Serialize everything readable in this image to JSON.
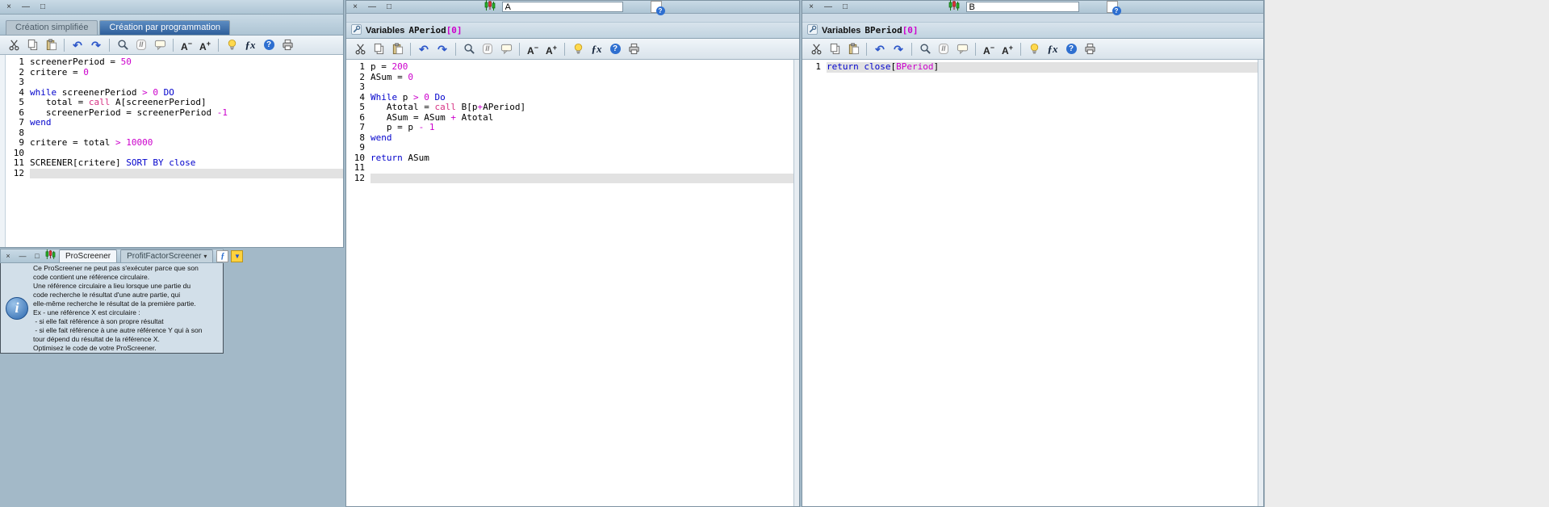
{
  "window_controls": {
    "close": "×",
    "minimize": "—",
    "maximize": "□"
  },
  "toolbar": {
    "items": [
      "cut",
      "copy",
      "paste",
      "sep",
      "undo",
      "redo",
      "sep",
      "search",
      "comment",
      "bubble",
      "sep",
      "font-smaller",
      "font-larger",
      "sep",
      "hint",
      "functions",
      "help",
      "print"
    ],
    "labels": {
      "undo": "↶",
      "redo": "↷",
      "comment": "//",
      "font": "A",
      "minus": "−",
      "plus": "+",
      "fx": "ƒx",
      "help": "?"
    }
  },
  "left_panel": {
    "tabs": [
      {
        "label": "Création simplifiée",
        "active": false
      },
      {
        "label": "Création par programmation",
        "active": true
      }
    ],
    "code": {
      "highlight_line": 12,
      "lines": [
        {
          "n": 1,
          "s": [
            {
              "t": "screenerPeriod = ",
              "c": "plain"
            },
            {
              "t": "50",
              "c": "num"
            }
          ]
        },
        {
          "n": 2,
          "s": [
            {
              "t": "critere = ",
              "c": "plain"
            },
            {
              "t": "0",
              "c": "num"
            }
          ]
        },
        {
          "n": 3,
          "s": []
        },
        {
          "n": 4,
          "s": [
            {
              "t": "while ",
              "c": "kw"
            },
            {
              "t": "screenerPeriod ",
              "c": "plain"
            },
            {
              "t": "> 0 ",
              "c": "num"
            },
            {
              "t": "DO",
              "c": "kw"
            }
          ]
        },
        {
          "n": 5,
          "s": [
            {
              "t": "   total = ",
              "c": "plain"
            },
            {
              "t": "call ",
              "c": "call"
            },
            {
              "t": "A[screenerPeriod]",
              "c": "plain"
            }
          ]
        },
        {
          "n": 6,
          "s": [
            {
              "t": "   screenerPeriod = screenerPeriod ",
              "c": "plain"
            },
            {
              "t": "-1",
              "c": "num"
            }
          ]
        },
        {
          "n": 7,
          "s": [
            {
              "t": "wend",
              "c": "kw"
            }
          ]
        },
        {
          "n": 8,
          "s": []
        },
        {
          "n": 9,
          "s": [
            {
              "t": "critere = total ",
              "c": "plain"
            },
            {
              "t": "> 10000",
              "c": "num"
            }
          ]
        },
        {
          "n": 10,
          "s": []
        },
        {
          "n": 11,
          "s": [
            {
              "t": "SCREENER[critere] ",
              "c": "plain"
            },
            {
              "t": "SORT BY close",
              "c": "kw"
            }
          ]
        },
        {
          "n": 12,
          "s": []
        }
      ]
    }
  },
  "panel_a": {
    "title_value": "A",
    "header": {
      "label": "Variables",
      "name": "APeriod",
      "index": "[0]"
    },
    "code": {
      "highlight_line": 12,
      "lines": [
        {
          "n": 1,
          "s": [
            {
              "t": "p = ",
              "c": "plain"
            },
            {
              "t": "200",
              "c": "num"
            }
          ]
        },
        {
          "n": 2,
          "s": [
            {
              "t": "ASum = ",
              "c": "plain"
            },
            {
              "t": "0",
              "c": "num"
            }
          ]
        },
        {
          "n": 3,
          "s": []
        },
        {
          "n": 4,
          "s": [
            {
              "t": "While ",
              "c": "kw"
            },
            {
              "t": "p ",
              "c": "plain"
            },
            {
              "t": "> 0 ",
              "c": "num"
            },
            {
              "t": "Do",
              "c": "kw"
            }
          ]
        },
        {
          "n": 5,
          "s": [
            {
              "t": "   Atotal = ",
              "c": "plain"
            },
            {
              "t": "call ",
              "c": "call"
            },
            {
              "t": "B[p",
              "c": "plain"
            },
            {
              "t": "+",
              "c": "num"
            },
            {
              "t": "APeriod]",
              "c": "plain"
            }
          ]
        },
        {
          "n": 6,
          "s": [
            {
              "t": "   ASum = ASum ",
              "c": "plain"
            },
            {
              "t": "+ ",
              "c": "num"
            },
            {
              "t": "Atotal",
              "c": "plain"
            }
          ]
        },
        {
          "n": 7,
          "s": [
            {
              "t": "   p = p ",
              "c": "plain"
            },
            {
              "t": "- ",
              "c": "num"
            },
            {
              "t": "1",
              "c": "num"
            }
          ]
        },
        {
          "n": 8,
          "s": [
            {
              "t": "wend",
              "c": "kw"
            }
          ]
        },
        {
          "n": 9,
          "s": []
        },
        {
          "n": 10,
          "s": [
            {
              "t": "return ",
              "c": "kw"
            },
            {
              "t": "ASum",
              "c": "plain"
            }
          ]
        },
        {
          "n": 11,
          "s": []
        },
        {
          "n": 12,
          "s": []
        }
      ]
    }
  },
  "panel_b": {
    "title_value": "B",
    "header": {
      "label": "Variables",
      "name": "BPeriod",
      "index": "[0]"
    },
    "code": {
      "highlight_line": 1,
      "lines": [
        {
          "n": 1,
          "s": [
            {
              "t": "return ",
              "c": "kw"
            },
            {
              "t": "close",
              "c": "kw"
            },
            {
              "t": "[",
              "c": "plain"
            },
            {
              "t": "BPeriod",
              "c": "num"
            },
            {
              "t": "]",
              "c": "plain"
            }
          ]
        }
      ]
    }
  },
  "popup": {
    "tabs": [
      {
        "label": "ProScreener",
        "active": true
      },
      {
        "label": "ProfitFactorScreener",
        "active": false,
        "dropdown": true
      }
    ],
    "message": "Ce ProScreener ne peut pas s'exécuter parce que son\ncode contient une référence circulaire.\nUne référence circulaire a lieu lorsque une partie du\ncode recherche le résultat d'une autre partie, qui\nelle-même recherche le résultat de la première partie.\nEx - une référence X est circulaire :\n - si elle fait référence à son propre résultat\n - si elle fait référence à une autre référence Y qui à son\ntour dépend du résultat de la référence X.\nOptimisez le code de votre ProScreener."
  },
  "colors": {
    "keyword": "#0202CC",
    "number": "#CC00CC",
    "call": "#D63384",
    "desktop": "#A3B9C8"
  }
}
